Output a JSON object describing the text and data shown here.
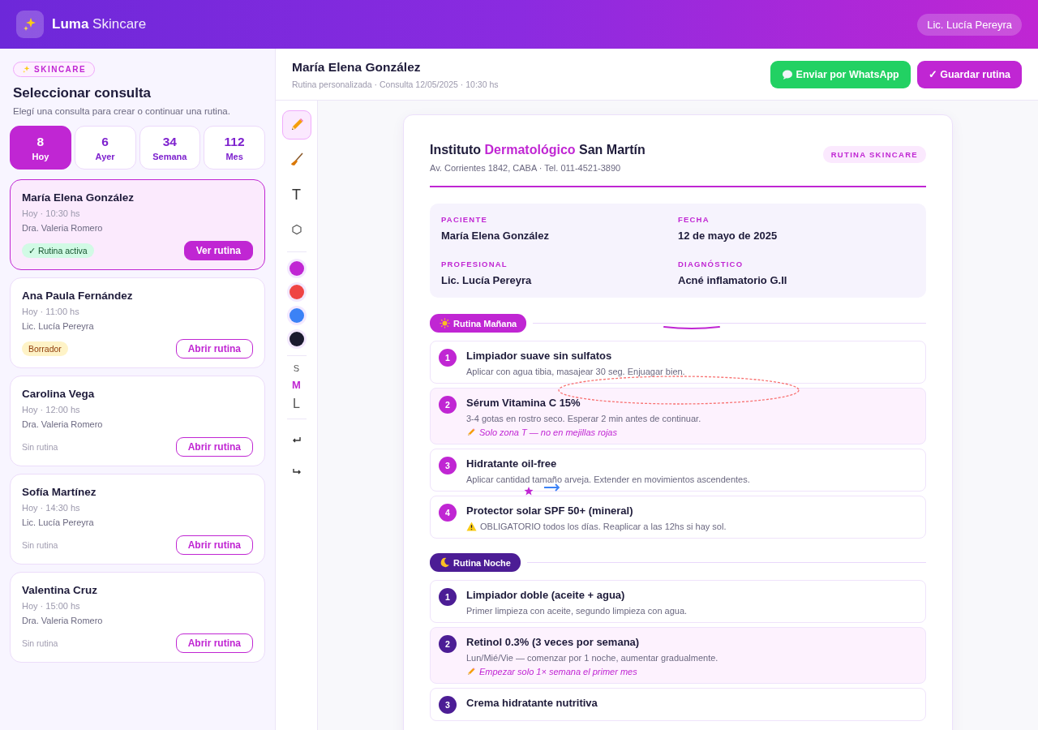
{
  "app": {
    "brand_bold": "Luma",
    "brand_light": "Skincare",
    "user": "Lic. Lucía Pereyra"
  },
  "sidebar": {
    "tag": "SKINCARE",
    "title": "Seleccionar consulta",
    "subtitle": "Elegí una consulta para crear o continuar una rutina.",
    "stats": [
      {
        "count": "8",
        "label": "Hoy",
        "selected": true
      },
      {
        "count": "6",
        "label": "Ayer",
        "selected": false
      },
      {
        "count": "34",
        "label": "Semana",
        "selected": false
      },
      {
        "count": "112",
        "label": "Mes",
        "selected": false
      }
    ],
    "consults": [
      {
        "name": "María Elena González",
        "time": "Hoy · 10:30 hs",
        "doctor": "Dra. Valeria Romero",
        "status": {
          "kind": "active",
          "label": "✓ Rutina activa"
        },
        "action": "Ver rutina",
        "selected": true
      },
      {
        "name": "Ana Paula Fernández",
        "time": "Hoy · 11:00 hs",
        "doctor": "Lic. Lucía Pereyra",
        "status": {
          "kind": "draft",
          "label": "Borrador"
        },
        "action": "Abrir rutina",
        "selected": false
      },
      {
        "name": "Carolina Vega",
        "time": "Hoy · 12:00 hs",
        "doctor": "Dra. Valeria Romero",
        "status": {
          "kind": "none",
          "label": "Sin rutina"
        },
        "action": "Abrir rutina",
        "selected": false
      },
      {
        "name": "Sofía Martínez",
        "time": "Hoy · 14:30 hs",
        "doctor": "Lic. Lucía Pereyra",
        "status": {
          "kind": "none",
          "label": "Sin rutina"
        },
        "action": "Abrir rutina",
        "selected": false
      },
      {
        "name": "Valentina Cruz",
        "time": "Hoy · 15:00 hs",
        "doctor": "Dra. Valeria Romero",
        "status": {
          "kind": "none",
          "label": "Sin rutina"
        },
        "action": "Abrir rutina",
        "selected": false
      }
    ]
  },
  "editor": {
    "patient": "María Elena González",
    "subtitle": "Rutina personalizada · Consulta 12/05/2025 · 10:30 hs",
    "buttons": [
      {
        "kind": "whatsapp",
        "label": "Enviar por WhatsApp"
      },
      {
        "kind": "save",
        "label": "✓ Guardar rutina"
      }
    ]
  },
  "tools": [
    {
      "kind": "pencil",
      "selected": true
    },
    {
      "kind": "brush",
      "selected": false
    },
    {
      "kind": "text",
      "label": "T",
      "selected": false
    },
    {
      "kind": "shape",
      "selected": false
    }
  ],
  "colors": [
    {
      "color": "#c026d3"
    },
    {
      "color": "#ef4444"
    },
    {
      "color": "#3b82f6"
    },
    {
      "color": "#1a1a2e"
    }
  ],
  "sizes": [
    {
      "label": "S",
      "selected": false
    },
    {
      "label": "M",
      "selected": true
    },
    {
      "label": "L",
      "selected": false
    }
  ],
  "history": [
    {
      "kind": "undo"
    },
    {
      "kind": "redo"
    }
  ],
  "document": {
    "institute": [
      "Instituto ",
      "Dermatológico",
      " San Martín"
    ],
    "address": "Av. Corrientes 1842, CABA · Tel. 011-4521-3890",
    "badge": "RUTINA SKINCARE",
    "info": [
      {
        "label": "PACIENTE",
        "value": "María Elena González"
      },
      {
        "label": "FECHA",
        "value": "12 de mayo de 2025"
      },
      {
        "label": "PROFESIONAL",
        "value": "Lic. Lucía Pereyra"
      },
      {
        "label": "DIAGNÓSTICO",
        "value": "Acné inflamatorio G.II"
      }
    ],
    "sections": [
      {
        "kind": "morning",
        "title": "Rutina Mañana",
        "steps": [
          {
            "number": "1",
            "title": "Limpiador suave sin sulfatos",
            "desc": "Aplicar con agua tibia, masajear 30 seg. Enjuagar bien.",
            "highlighted": false
          },
          {
            "number": "2",
            "title": "Sérum Vitamina C 15%",
            "desc": "3-4 gotas en rostro seco. Esperar 2 min antes de continuar.",
            "note": "Solo zona T — no en mejillas rojas",
            "highlighted": true
          },
          {
            "number": "3",
            "title": "Hidratante oil-free",
            "desc": "Aplicar cantidad tamaño arveja. Extender en movimientos ascendentes.",
            "highlighted": false
          },
          {
            "number": "4",
            "title": "Protector solar SPF 50+ (mineral)",
            "desc": "OBLIGATORIO todos los días. Reaplicar a las 12hs si hay sol.",
            "warning": true,
            "highlighted": false
          }
        ]
      },
      {
        "kind": "night",
        "title": "Rutina Noche",
        "steps": [
          {
            "number": "1",
            "title": "Limpiador doble (aceite + agua)",
            "desc": "Primer limpieza con aceite, segundo limpieza con agua.",
            "highlighted": false
          },
          {
            "number": "2",
            "title": "Retinol 0.3% (3 veces por semana)",
            "desc": "Lun/Mié/Vie — comenzar por 1 noche, aumentar gradualmente.",
            "note": "Empezar solo 1× semana el primer mes",
            "highlighted": true
          },
          {
            "number": "3",
            "title": "Crema hidratante nutritiva",
            "highlighted": false
          }
        ]
      }
    ]
  }
}
